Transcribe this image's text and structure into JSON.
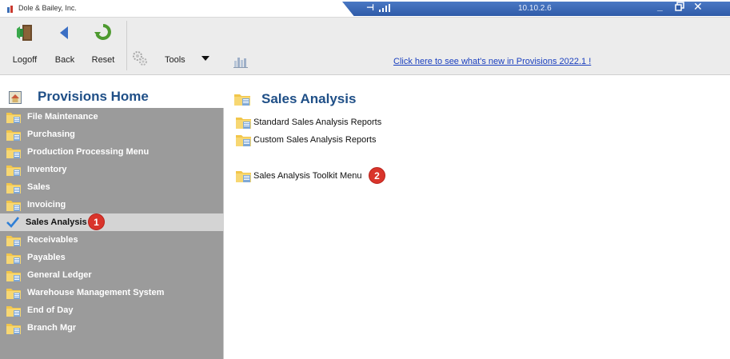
{
  "window": {
    "app_title": "Dole & Bailey, Inc.",
    "connection_ip": "10.10.2.6",
    "minimize_glyph": "_",
    "close_glyph": "✕",
    "pin_glyph": "⊣"
  },
  "toolbar": {
    "logoff_label": "Logoff",
    "back_label": "Back",
    "reset_label": "Reset",
    "tools_label": "Tools",
    "whats_new_link": "Click here to see what's new in Provisions 2022.1 !"
  },
  "sidebar": {
    "title": "Provisions Home",
    "items": [
      {
        "label": "File Maintenance",
        "icon": "folder-icon"
      },
      {
        "label": "Purchasing",
        "icon": "folder-icon"
      },
      {
        "label": "Production Processing Menu",
        "icon": "folder-icon"
      },
      {
        "label": "Inventory",
        "icon": "folder-icon"
      },
      {
        "label": "Sales",
        "icon": "folder-icon"
      },
      {
        "label": "Invoicing",
        "icon": "folder-icon"
      },
      {
        "label": "Sales Analysis",
        "icon": "checkmark-icon",
        "selected": true
      },
      {
        "label": "Receivables",
        "icon": "folder-icon"
      },
      {
        "label": "Payables",
        "icon": "folder-icon"
      },
      {
        "label": "General Ledger",
        "icon": "folder-icon"
      },
      {
        "label": "Warehouse Management System",
        "icon": "folder-icon"
      },
      {
        "label": "End of Day",
        "icon": "folder-icon"
      },
      {
        "label": "Branch Mgr",
        "icon": "folder-icon"
      }
    ]
  },
  "main": {
    "title": "Sales Analysis",
    "items": [
      {
        "label": "Standard Sales Analysis Reports"
      },
      {
        "label": "Custom Sales Analysis Reports"
      },
      {
        "label": "Sales Analysis Toolkit Menu"
      }
    ]
  },
  "badges": {
    "one": "1",
    "two": "2"
  },
  "colors": {
    "accent_blue": "#1f4f87",
    "title_bar_blue": "#2f5ba8",
    "sidebar_bg": "#9b9b9b",
    "badge_red": "#d9342b",
    "link_blue": "#1a3fbf"
  }
}
